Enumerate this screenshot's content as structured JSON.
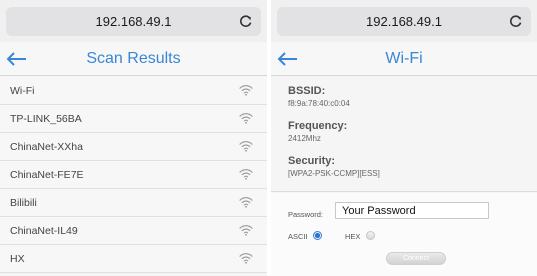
{
  "left": {
    "url": "192.168.49.1",
    "title": "Scan Results",
    "networks": [
      {
        "ssid": "Wi-Fi"
      },
      {
        "ssid": "TP-LINK_56BA"
      },
      {
        "ssid": "ChinaNet-XXha"
      },
      {
        "ssid": "ChinaNet-FE7E"
      },
      {
        "ssid": "Bilibili"
      },
      {
        "ssid": "ChinaNet-IL49"
      },
      {
        "ssid": "HX"
      }
    ]
  },
  "right": {
    "url": "192.168.49.1",
    "title": "Wi-Fi",
    "bssid_label": "BSSID:",
    "bssid_value": "f8:9a:78:40:c0:04",
    "frequency_label": "Frequency:",
    "frequency_value": "2412Mhz",
    "security_label": "Security:",
    "security_value": "[WPA2-PSK-CCMP][ESS]",
    "password_label": "Password:",
    "password_value": "Your Password",
    "encoding_selected": "ASCII",
    "ascii_label": "ASCII",
    "hex_label": "HEX",
    "connect_label": "Connect"
  },
  "colors": {
    "accent": "#3a86d6",
    "wifi_icon": "#9a9a9a"
  },
  "icons": {
    "back": "left-arrow-icon",
    "reload": "reload-icon",
    "signal": "wifi-signal-icon"
  }
}
